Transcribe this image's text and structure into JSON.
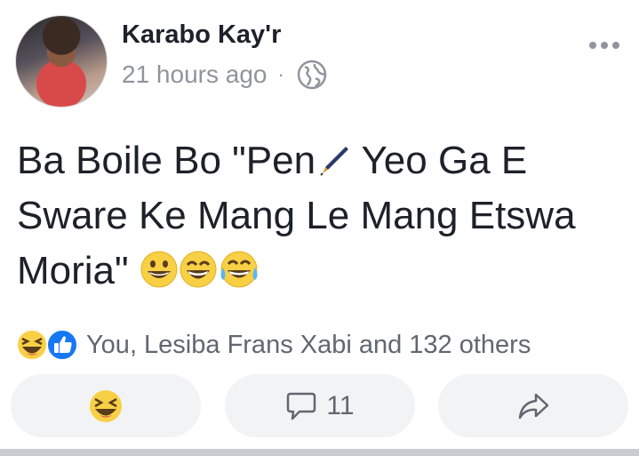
{
  "post": {
    "author": "Karabo Kay'r",
    "timestamp": "21 hours ago",
    "separator": "·",
    "privacy_icon": "globe-icon",
    "text_part1": "Ba Boile Bo \"Pen",
    "text_part2": " Yeo Ga E Sware Ke Mang Le Mang Etswa Moria\" ",
    "inline_icons": [
      "pen-icon",
      "grinning-emoji",
      "laughing-emoji",
      "tears-of-joy-emoji"
    ]
  },
  "reactions": {
    "icons": [
      "haha-reaction-icon",
      "like-reaction-icon"
    ],
    "summary": "You, Lesiba Frans Xabi and 132 others"
  },
  "actions": {
    "react_icon": "haha-reaction-icon",
    "comment_count": "11",
    "comment_icon": "comment-icon",
    "share_icon": "share-icon"
  },
  "colors": {
    "text": "#1d2129",
    "muted": "#90949c",
    "button_bg": "#f2f3f5",
    "like_blue": "#1877f2",
    "emoji_yellow": "#f7d046"
  }
}
